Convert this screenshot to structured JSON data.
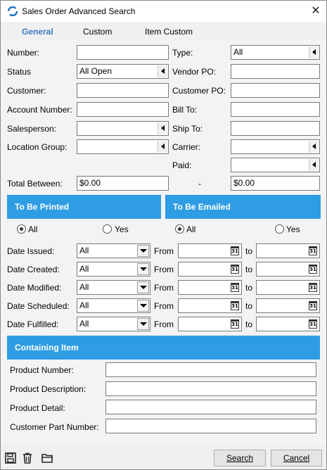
{
  "window": {
    "title": "Sales Order Advanced Search",
    "close_glyph": "✕"
  },
  "tabs": [
    {
      "label": "General",
      "active": true
    },
    {
      "label": "Custom",
      "active": false
    },
    {
      "label": "Item Custom",
      "active": false
    }
  ],
  "form": {
    "number": {
      "label": "Number:",
      "value": ""
    },
    "type": {
      "label": "Type:",
      "value": "All"
    },
    "status": {
      "label": "Status",
      "value": "All Open"
    },
    "vendor_po": {
      "label": "Vendor PO:",
      "value": ""
    },
    "customer": {
      "label": "Customer:",
      "value": ""
    },
    "customer_po": {
      "label": "Customer PO:",
      "value": ""
    },
    "account_number": {
      "label": "Account Number:",
      "value": ""
    },
    "bill_to": {
      "label": "Bill To:",
      "value": ""
    },
    "salesperson": {
      "label": "Salesperson:",
      "value": ""
    },
    "ship_to": {
      "label": "Ship To:",
      "value": ""
    },
    "location_group": {
      "label": "Location Group:",
      "value": ""
    },
    "carrier": {
      "label": "Carrier:",
      "value": ""
    },
    "paid": {
      "label": "Paid:",
      "value": ""
    },
    "total_between": {
      "label": "Total Between:",
      "from": "$0.00",
      "separator": "-",
      "to": "$0.00"
    }
  },
  "printed": {
    "heading": "To Be Printed",
    "all_label": "All",
    "yes_label": "Yes",
    "selected": "All"
  },
  "emailed": {
    "heading": "To Be Emailed",
    "all_label": "All",
    "yes_label": "Yes",
    "selected": "All"
  },
  "dates": {
    "from_label": "From",
    "to_label": "to",
    "calendar_day": "31",
    "rows": [
      {
        "label": "Date Issued:",
        "value": "All"
      },
      {
        "label": "Date Created:",
        "value": "All"
      },
      {
        "label": "Date Modified:",
        "value": "All"
      },
      {
        "label": "Date Scheduled:",
        "value": "All"
      },
      {
        "label": "Date Fulfilled:",
        "value": "All"
      }
    ]
  },
  "containing_item": {
    "heading": "Containing Item",
    "product_number": {
      "label": "Product Number:",
      "value": ""
    },
    "product_description": {
      "label": "Product Description:",
      "value": ""
    },
    "product_detail": {
      "label": "Product Detail:",
      "value": ""
    },
    "customer_part_number": {
      "label": "Customer Part Number:",
      "value": ""
    }
  },
  "footer": {
    "icons": [
      "save-icon",
      "delete-icon",
      "open-folder-icon"
    ],
    "search_label": "Search",
    "cancel_label": "Cancel"
  },
  "colors": {
    "accent": "#2f9de4",
    "active_tab": "#3d7ac2"
  }
}
